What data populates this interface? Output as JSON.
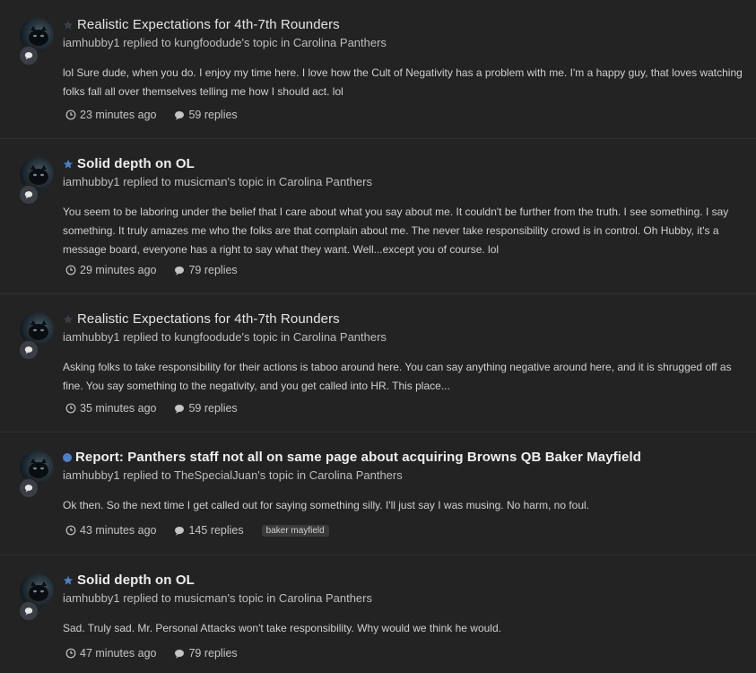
{
  "entries": [
    {
      "featured": false,
      "marker": "star-outline",
      "title": "Realistic Expectations for 4th-7th Rounders",
      "meta": "iamhubby1 replied to kungfoodude's topic in Carolina Panthers",
      "excerpt": "lol Sure dude, when you do. I enjoy my time here. I love how the Cult of Negativity has a problem with me. I'm a happy guy, that loves watching folks fall all over themselves telling me how I should act. lol",
      "time": "23 minutes ago",
      "replies": "59 replies",
      "tag": ""
    },
    {
      "featured": true,
      "marker": "star-filled",
      "title": "Solid depth on OL",
      "meta": "iamhubby1 replied to musicman's topic in Carolina Panthers",
      "excerpt": "You seem to be laboring under the belief that I care about what you say about me. It couldn't be further from the truth. I see something. I say something. It truly amazes me who the folks are that complain about me. The never take responsibility crowd is in control. Oh Hubby, it's a message board, everyone has a right to say what they want. Well...except you of course. lol",
      "time": "29 minutes ago",
      "replies": "79 replies",
      "tag": ""
    },
    {
      "featured": false,
      "marker": "star-outline",
      "title": "Realistic Expectations for 4th-7th Rounders",
      "meta": "iamhubby1 replied to kungfoodude's topic in Carolina Panthers",
      "excerpt": "Asking folks to take responsibility for their actions is taboo around here. You can say anything negative around here, and it is shrugged off as fine. You say something to the negativity, and you get called into HR. This place...",
      "time": "35 minutes ago",
      "replies": "59 replies",
      "tag": ""
    },
    {
      "featured": true,
      "marker": "unread-dot",
      "title": "Report: Panthers staff not all on same page about acquiring Browns QB Baker Mayfield",
      "meta": "iamhubby1 replied to TheSpecialJuan's topic in Carolina Panthers",
      "excerpt": "Ok then. So the next time I get called out for saying something silly. I'll just say I was musing. No harm, no foul.",
      "time": "43 minutes ago",
      "replies": "145 replies",
      "tag": "baker mayfield"
    },
    {
      "featured": true,
      "marker": "star-filled",
      "title": "Solid depth on OL",
      "meta": "iamhubby1 replied to musicman's topic in Carolina Panthers",
      "excerpt": "Sad. Truly sad. Mr. Personal Attacks won't take responsibility. Why would we think he would.",
      "time": "47 minutes ago",
      "replies": "79 replies",
      "tag": ""
    }
  ],
  "colors": {
    "background": "#232323",
    "accent": "#4a80c8",
    "divider": "#303030"
  }
}
